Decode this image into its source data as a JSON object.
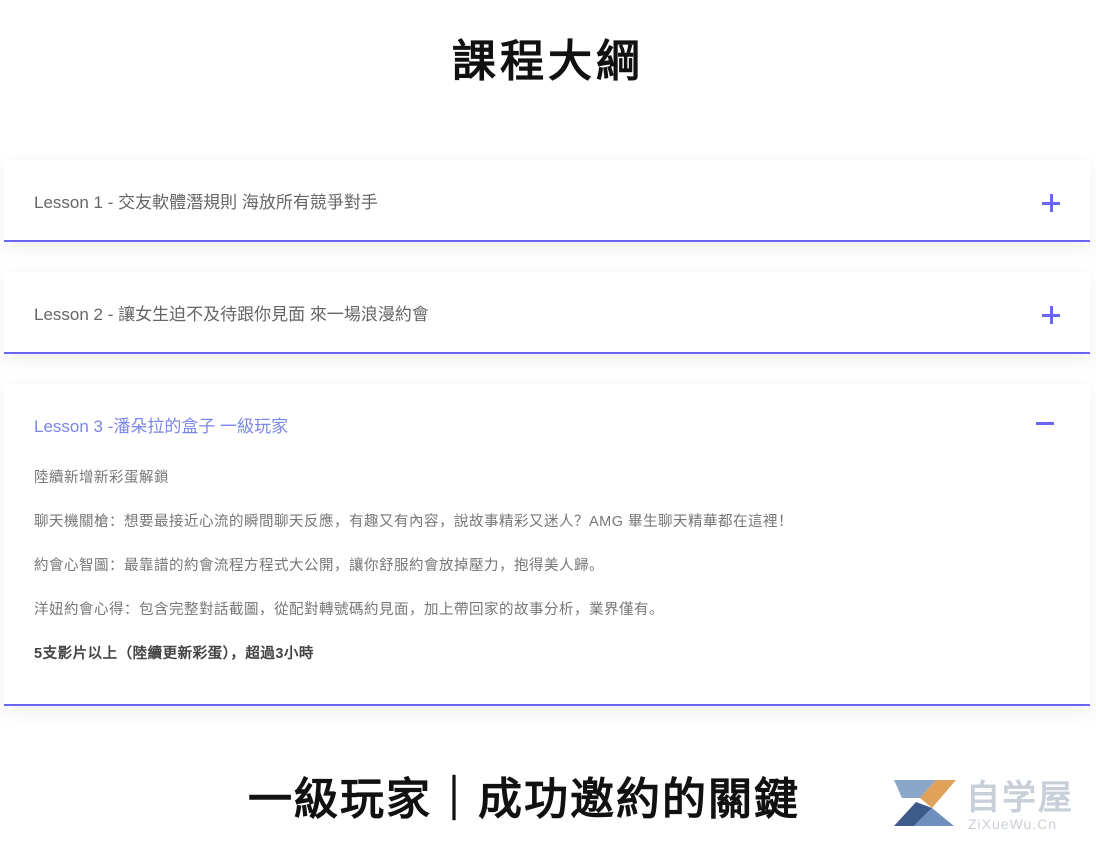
{
  "page": {
    "title": "課程大綱",
    "bottom_heading": "一級玩家｜成功邀約的關鍵"
  },
  "lessons": [
    {
      "title": "Lesson 1 - 交友軟體潛規則 海放所有競爭對手",
      "expanded": false,
      "toggle_icon": "plus-icon"
    },
    {
      "title": "Lesson 2 - 讓女生迫不及待跟你見面 來一場浪漫約會",
      "expanded": false,
      "toggle_icon": "plus-icon"
    },
    {
      "title": "Lesson 3 -潘朵拉的盒子 一級玩家",
      "expanded": true,
      "toggle_icon": "minus-icon",
      "body": [
        "陸續新增新彩蛋解鎖",
        "聊天機關槍：想要最接近心流的瞬間聊天反應，有趣又有內容，說故事精彩又迷人？AMG 畢生聊天精華都在這裡！",
        "約會心智圖：最靠譜的約會流程方程式大公開，讓你舒服約會放掉壓力，抱得美人歸。",
        "洋妞約會心得：包含完整對話截圖，從配對轉號碼約見面，加上帶回家的故事分析，業界僅有。",
        "5支影片以上（陸續更新彩蛋），超過3小時"
      ]
    }
  ],
  "watermark": {
    "cn": "自学屋",
    "en": "ZiXueWu.Cn"
  },
  "colors": {
    "accent": "#6a66ef",
    "active_title": "#7a86e8",
    "text_muted": "#666666"
  }
}
